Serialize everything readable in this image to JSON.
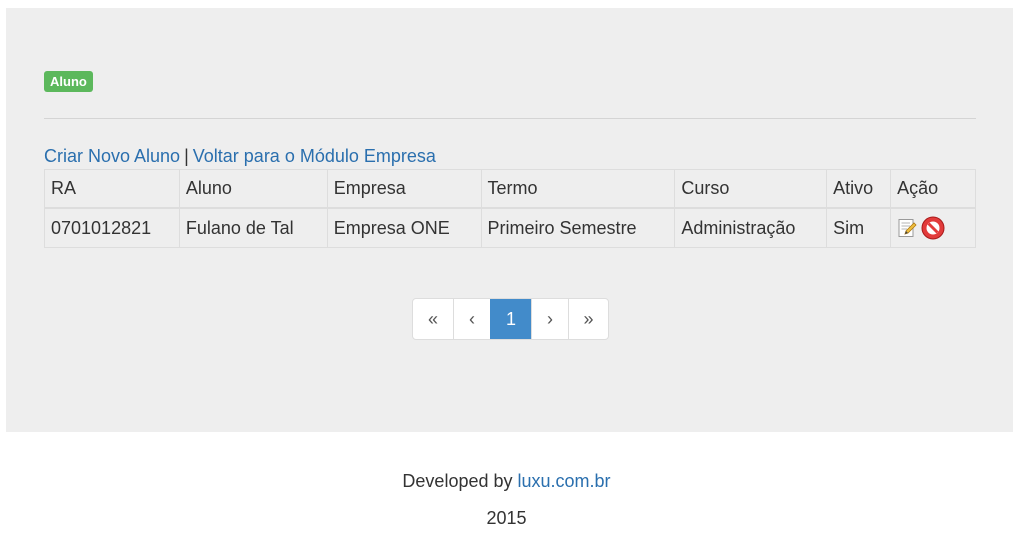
{
  "badge": {
    "label": "Aluno",
    "color": "#5cb85c"
  },
  "links": {
    "create_label": "Criar Novo Aluno",
    "separator": "|",
    "back_label": "Voltar para o Módulo Empresa"
  },
  "table": {
    "headers": [
      "RA",
      "Aluno",
      "Empresa",
      "Termo",
      "Curso",
      "Ativo",
      "Ação"
    ],
    "rows": [
      {
        "ra": "0701012821",
        "aluno": "Fulano de Tal",
        "empresa": "Empresa ONE",
        "termo": "Primeiro Semestre",
        "curso": "Administração",
        "ativo": "Sim",
        "actions": [
          "edit-icon",
          "delete-icon"
        ]
      }
    ]
  },
  "pagination": {
    "first": "«",
    "prev": "‹",
    "current": "1",
    "next": "›",
    "last": "»",
    "active_color": "#428bca"
  },
  "footer": {
    "developed_by": "Developed by",
    "link_label": "luxu.com.br",
    "year": "2015"
  }
}
